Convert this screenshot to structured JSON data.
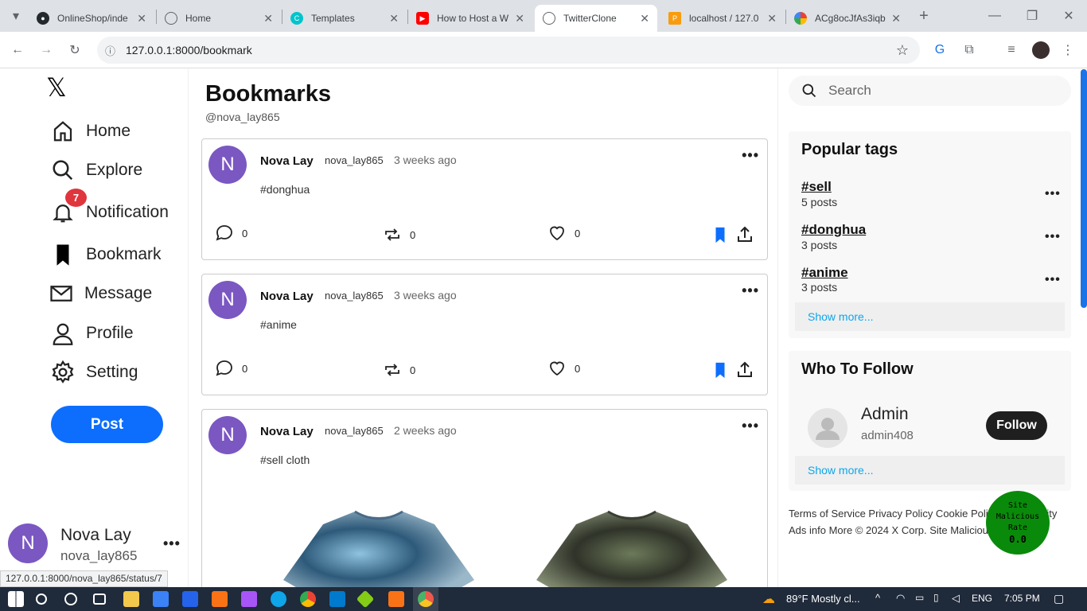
{
  "browser": {
    "tabs": [
      {
        "label": "OnlineShop/inde",
        "icon": "github-icon"
      },
      {
        "label": "Home",
        "icon": "globe-icon"
      },
      {
        "label": "Templates",
        "icon": "canva-icon"
      },
      {
        "label": "How to Host a W",
        "icon": "youtube-icon"
      },
      {
        "label": "TwitterClone",
        "icon": "globe-icon"
      },
      {
        "label": "localhost / 127.0",
        "icon": "phpmyadmin-icon"
      },
      {
        "label": "ACg8ocJfAs3iqb",
        "icon": "google-photos-icon"
      }
    ],
    "url": "127.0.0.1:8000/bookmark"
  },
  "nav": {
    "logo": "𝕏",
    "items": [
      {
        "label": "Home",
        "icon": "home-icon"
      },
      {
        "label": "Explore",
        "icon": "search-icon"
      },
      {
        "label": "Notification",
        "icon": "bell-icon"
      },
      {
        "label": "Bookmark",
        "icon": "bookmark-icon"
      },
      {
        "label": "Message",
        "icon": "mail-icon"
      },
      {
        "label": "Profile",
        "icon": "user-icon"
      },
      {
        "label": "Setting",
        "icon": "gear-icon"
      }
    ],
    "notification_count": "7",
    "post_label": "Post",
    "user": {
      "initial": "N",
      "name": "Nova Lay",
      "handle": "nova_lay865"
    }
  },
  "main": {
    "title": "Bookmarks",
    "handle": "@nova_lay865",
    "posts": [
      {
        "initial": "N",
        "name": "Nova Lay",
        "handle": "nova_lay865",
        "time": "3 weeks ago",
        "text": "#donghua",
        "comments": "0",
        "reposts": "0",
        "likes": "0"
      },
      {
        "initial": "N",
        "name": "Nova Lay",
        "handle": "nova_lay865",
        "time": "3 weeks ago",
        "text": "#anime",
        "comments": "0",
        "reposts": "0",
        "likes": "0"
      },
      {
        "initial": "N",
        "name": "Nova Lay",
        "handle": "nova_lay865",
        "time": "2 weeks ago",
        "text": "#sell cloth"
      }
    ]
  },
  "right": {
    "search_placeholder": "Search",
    "popular_title": "Popular tags",
    "tags": [
      {
        "name": "#sell",
        "count": "5 posts"
      },
      {
        "name": "#donghua",
        "count": "3 posts"
      },
      {
        "name": "#anime",
        "count": "3 posts"
      }
    ],
    "show_more": "Show more...",
    "follow_title": "Who To Follow",
    "follow_user": {
      "name": "Admin",
      "handle": "admin408",
      "button": "Follow"
    },
    "footer_line1": "Terms of Service Privacy Policy Cookie Policy Accessibility",
    "footer_line2": "Ads info More © 2024 X Corp. Site Malicious Rate",
    "malicious": {
      "line1": "Site",
      "line2": "Malicious",
      "line3": "Rate",
      "value": "0.0"
    }
  },
  "status_url": "127.0.0.1:8000/nova_lay865/status/7",
  "taskbar": {
    "weather": "89°F  Mostly cl...",
    "lang": "ENG",
    "time": "7:05 PM"
  },
  "colors": {
    "accent": "#0d6efd",
    "avatar": "#7b57c2",
    "badge": "#e0353d",
    "link": "#0ea5e9"
  }
}
